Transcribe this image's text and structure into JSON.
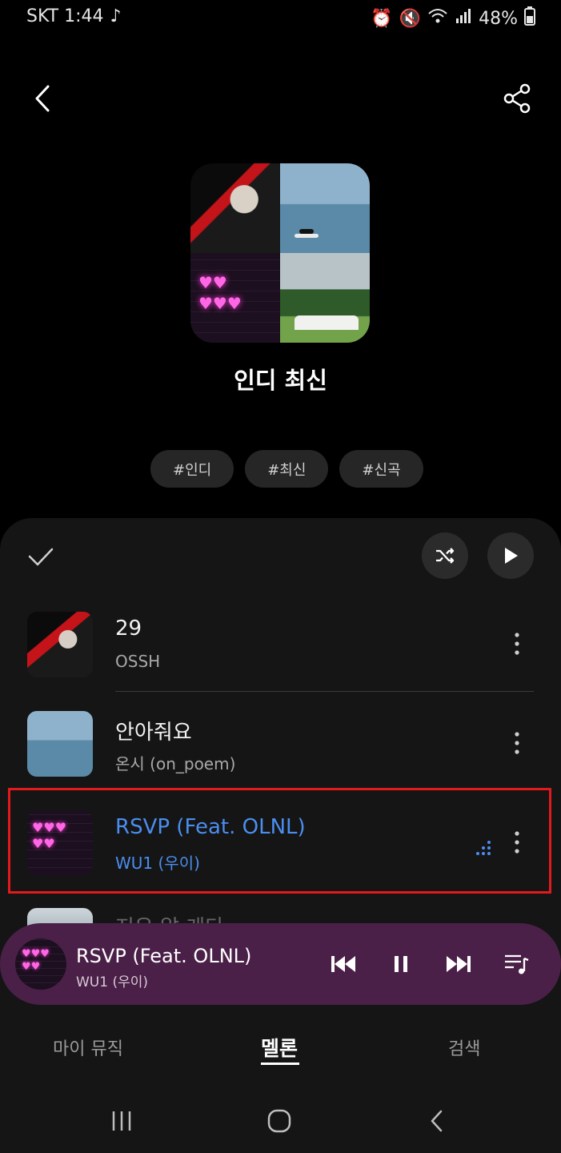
{
  "status_bar": {
    "carrier_time": "SKT 1:44",
    "battery": "48%"
  },
  "playlist": {
    "title": "인디 최신",
    "tags": [
      "#인디",
      "#최신",
      "#신곡"
    ]
  },
  "tracks": [
    {
      "title": "29",
      "artist": "OSSH"
    },
    {
      "title": "안아줘요",
      "artist": "온시 (on_poem)"
    },
    {
      "title": "RSVP (Feat. OLNL)",
      "artist": "WU1 (우이)",
      "playing": true
    },
    {
      "title": "지우 알 게다"
    }
  ],
  "mini_player": {
    "title": "RSVP (Feat. OLNL)",
    "artist": "WU1 (우이)",
    "background": "#4b2048"
  },
  "bottom_nav": {
    "items": [
      "마이 뮤직",
      "멜론",
      "검색"
    ],
    "active": "멜론"
  },
  "colors": {
    "accent": "#4a8ef0",
    "highlight_box": "#e3191d"
  }
}
